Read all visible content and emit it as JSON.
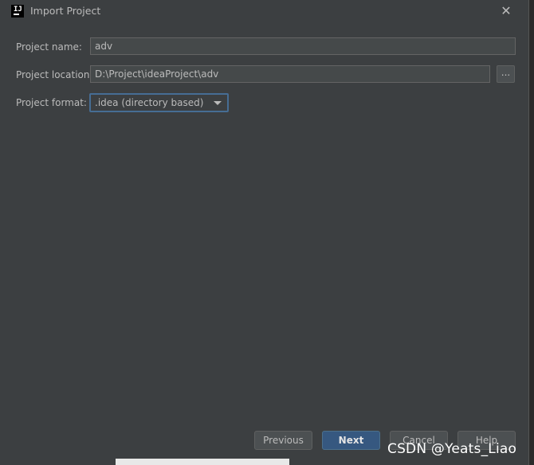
{
  "window": {
    "title": "Import Project"
  },
  "form": {
    "name_label": "Project name:",
    "name_value": "adv",
    "location_label": "Project location:",
    "location_value": "D:\\Project\\ideaProject\\adv",
    "browse_label": "...",
    "format_label": "Project format:",
    "format_value": ".idea (directory based)"
  },
  "buttons": {
    "previous": "Previous",
    "next": "Next",
    "cancel": "Cancel",
    "help": "Help"
  },
  "watermark": "CSDN @Yeats_Liao",
  "colors": {
    "dialog_bg": "#3c3f41",
    "field_bg": "#45494a",
    "focus_border": "#466d94",
    "primary_button": "#365880"
  }
}
